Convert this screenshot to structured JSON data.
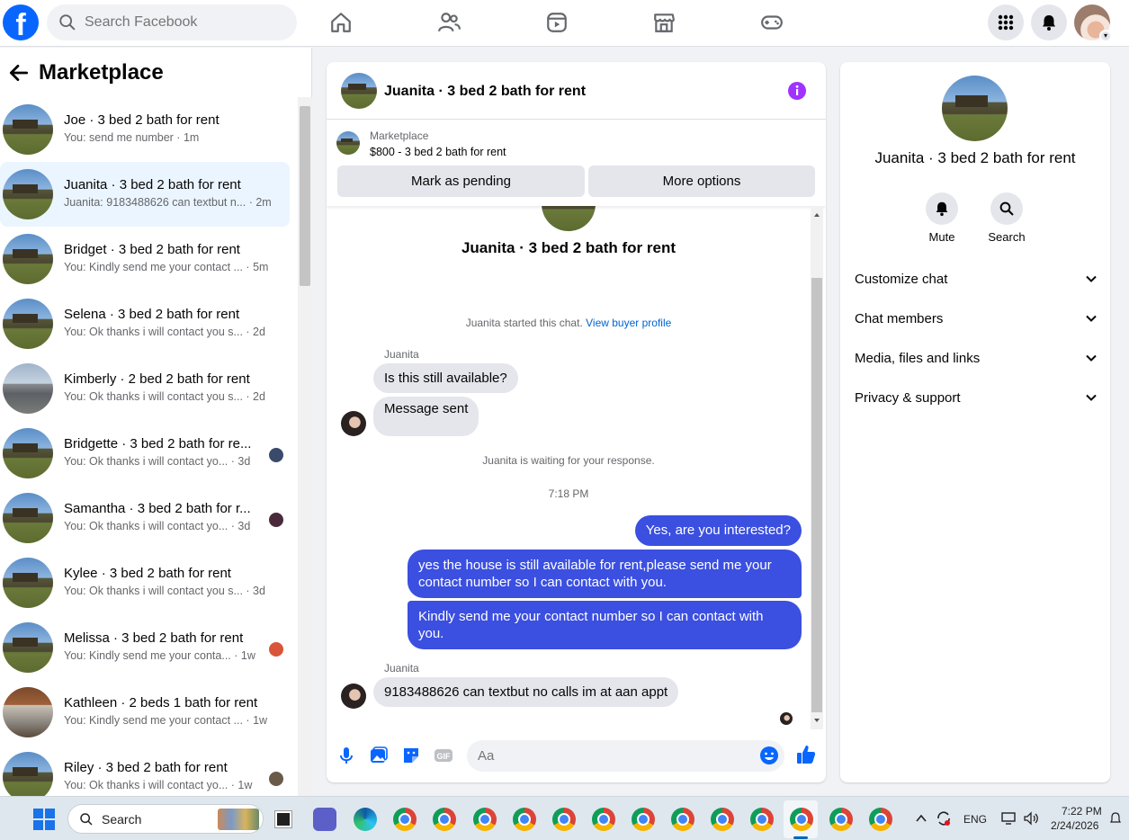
{
  "topbar": {
    "search_placeholder": "Search Facebook"
  },
  "marketplace": {
    "title": "Marketplace",
    "conversations": [
      {
        "name": "Joe · 3 bed 2 bath for rent",
        "preview": "You: send me number · 1m",
        "thumb": "house"
      },
      {
        "name": "Juanita · 3 bed 2 bath for rent",
        "preview": "Juanita: 9183488626 can textbut n... · 2m",
        "thumb": "house",
        "active": true
      },
      {
        "name": "Bridget · 3 bed 2 bath for rent",
        "preview": "You: Kindly send me your contact ... · 5m",
        "thumb": "house"
      },
      {
        "name": "Selena · 3 bed 2 bath for rent",
        "preview": "You: Ok thanks i will contact you s... · 2d",
        "thumb": "house"
      },
      {
        "name": "Kimberly · 2 bed 2 bath for rent",
        "preview": "You: Ok thanks i will contact you s... · 2d",
        "thumb": "house2"
      },
      {
        "name": "Bridgette · 3 bed 2 bath for re...",
        "preview": "You: Ok thanks i will contact yo... · 3d",
        "thumb": "house",
        "mini": "#3a4a6a"
      },
      {
        "name": "Samantha · 3 bed 2 bath for r...",
        "preview": "You: Ok thanks i will contact yo... · 3d",
        "thumb": "house",
        "mini": "#4a2a3a"
      },
      {
        "name": "Kylee · 3 bed 2 bath for rent",
        "preview": "You: Ok thanks i will contact you s... · 3d",
        "thumb": "house"
      },
      {
        "name": "Melissa · 3 bed 2 bath for rent",
        "preview": "You: Kindly send me your conta... · 1w",
        "thumb": "house",
        "mini": "#d9553a"
      },
      {
        "name": "Kathleen · 2 beds 1 bath for rent",
        "preview": "You: Kindly send me your contact ... · 1w",
        "thumb": "kitchen"
      },
      {
        "name": "Riley · 3 bed 2 bath for rent",
        "preview": "You: Ok thanks i will contact yo... · 1w",
        "thumb": "house",
        "mini": "#6a5a4a"
      }
    ]
  },
  "chat": {
    "title": "Juanita · 3 bed 2 bath for rent",
    "listing_label": "Marketplace",
    "listing_price": "$800 - 3 bed 2 bath for rent",
    "mark_pending": "Mark as pending",
    "more_options": "More options",
    "conv_title": "Juanita · 3 bed 2 bath for rent",
    "started_text": "Juanita started this chat.",
    "buyer_profile_link": "View buyer profile",
    "sender1": "Juanita",
    "msg1": "Is this still available?",
    "msg2": "Message sent",
    "waiting": "Juanita is waiting for your response.",
    "time": "7:18 PM",
    "out1": "Yes, are you interested?",
    "out2": "yes the house is still available for rent,please send me your contact number so I can contact with you.",
    "out3": "Kindly send me your contact number so I can contact with you.",
    "sender2": "Juanita",
    "msg3": "9183488626 can textbut no calls im at aan appt",
    "input_placeholder": "Aa"
  },
  "details": {
    "title": "Juanita · 3 bed 2 bath for rent",
    "mute": "Mute",
    "search": "Search",
    "rows": [
      "Customize chat",
      "Chat members",
      "Media, files and links",
      "Privacy & support"
    ]
  },
  "taskbar": {
    "search": "Search",
    "lang": "ENG",
    "time": "7:22 PM",
    "date": "2/24/2026"
  },
  "colors": {
    "facebook_blue": "#0866ff",
    "outgoing_bubble": "#3b4fe0",
    "info_purple": "#a033ff"
  }
}
